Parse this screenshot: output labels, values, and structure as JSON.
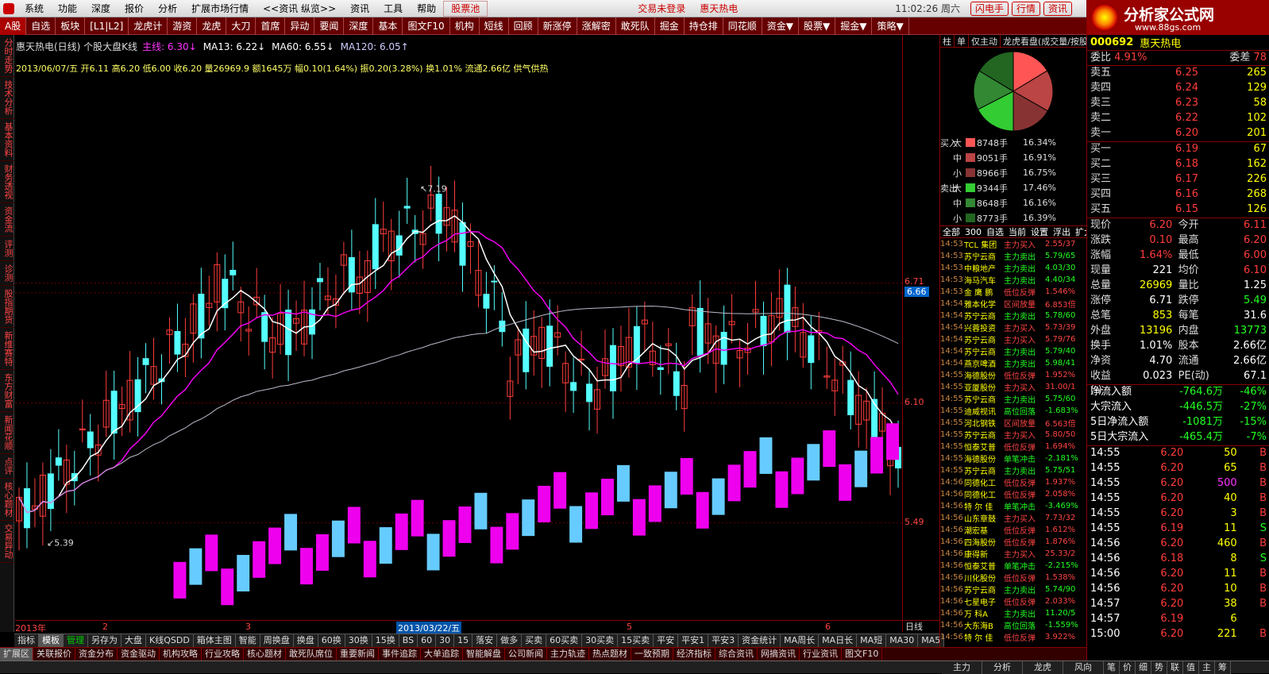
{
  "menubar": {
    "items": [
      "系统",
      "功能",
      "深度",
      "报价",
      "分析",
      "扩展市场行情",
      "<<资讯 纵览>>",
      "资讯",
      "工具",
      "帮助",
      "股票池"
    ],
    "login": "交易未登录",
    "stock": "惠天热电",
    "time": "11:02:26 周六",
    "buttons": [
      "闪电手",
      "行情",
      "资讯"
    ]
  },
  "tabbar": {
    "items": [
      "A股",
      "自选",
      "板块",
      "[L1|L2]",
      "龙虎计",
      "游资",
      "龙虎",
      "大刀",
      "首席",
      "异动",
      "要闻",
      "深度",
      "基本",
      "图文F10",
      "机构",
      "短线",
      "回顾",
      "新涨停",
      "涨解密",
      "敢死队",
      "掘金",
      "持仓排",
      "同花顺",
      "资金▼",
      "股票▼",
      "掘金▼",
      "策略▼"
    ]
  },
  "leftnav": [
    "分时走势",
    "技术分析",
    "基本资料",
    "财务透视",
    "资金流",
    "评测",
    "诊测",
    "股指期货",
    "新维赛特",
    "东方财富",
    "新闻花顺",
    "点评",
    "核心题材",
    "交易异动"
  ],
  "logo": {
    "text": "分析家公式网",
    "url": "www.88gs.com"
  },
  "chart": {
    "title": "惠天热电(日线) 个股大盘K线",
    "main_label": "主线: 6.30↓",
    "ma13": "MA13: 6.22↓",
    "ma60": "MA60: 6.55↓",
    "ma120": "MA120: 6.05↑",
    "info": "2013/06/07/五 开6.11 高6.20 低6.00 收6.20 量26969.9 额1645万 幅0.10(1.64%) 振0.20(3.28%) 换1.01% 流通2.66亿 供气供热",
    "high_label": "7.19",
    "low_label": "5.39",
    "price_axis": [
      "6.71",
      "6.66",
      "6.10",
      "5.49"
    ],
    "price_vals": [
      6.71,
      6.66,
      6.1,
      5.49
    ],
    "current_price": "6.66",
    "date_axis": [
      "2013年",
      "2",
      "3",
      "2013/03/22/五",
      "5",
      "6"
    ],
    "period": "日线",
    "colors": {
      "up": "#ff3c3c",
      "down": "#5ff",
      "white": "#fff",
      "ma_mag": "#e0e",
      "ma_grey": "#bbc",
      "vol_up": "#e0e",
      "vol_down": "#6cf"
    }
  },
  "bottom1": [
    "指标",
    "模板",
    "管理",
    "另存为",
    "大盘",
    "K线QSDD",
    "箱体主图",
    "智能",
    "周换盘",
    "换盘",
    "60换",
    "30换",
    "15换",
    "BS",
    "60",
    "30",
    "15",
    "落安",
    "做多",
    "买卖",
    "60买卖",
    "30买卖",
    "15买卖",
    "平安",
    "平安1",
    "平安3",
    "资金统计",
    "MA周长",
    "MA日长",
    "MA短",
    "MA30",
    "MA5"
  ],
  "bottom2": [
    "扩展区",
    "关联报价",
    "资金分布",
    "资金驱动",
    "机构攻略",
    "行业攻略",
    "核心题材",
    "敢死队席位",
    "重要新闻",
    "事件追踪",
    "大单追踪",
    "智能解盘",
    "公司新闻",
    "主力轨迹",
    "热点题材",
    "一致预期",
    "经济指标",
    "综合资讯",
    "网摘资讯",
    "行业资讯",
    "图文F10"
  ],
  "status_tabs": [
    "主力",
    "分析",
    "龙虎",
    "风向",
    "笔",
    "价",
    "细",
    "势",
    "联",
    "值",
    "主",
    "筹"
  ],
  "mid": {
    "tabs": [
      "柱",
      "单",
      "仅主动",
      "龙虎看盘(成交量/按股)"
    ],
    "flow": [
      {
        "side": "买入",
        "size": "大",
        "vol": "8748手",
        "pct": "16.34%",
        "color": "#ff5555"
      },
      {
        "side": "",
        "size": "中",
        "vol": "9051手",
        "pct": "16.91%",
        "color": "#b44"
      },
      {
        "side": "",
        "size": "小",
        "vol": "8966手",
        "pct": "16.75%",
        "color": "#833"
      },
      {
        "side": "卖出",
        "size": "大",
        "vol": "9344手",
        "pct": "17.46%",
        "color": "#3c3"
      },
      {
        "side": "",
        "size": "中",
        "vol": "8648手",
        "pct": "16.16%",
        "color": "#383"
      },
      {
        "side": "",
        "size": "小",
        "vol": "8773手",
        "pct": "16.39%",
        "color": "#262"
      }
    ],
    "filters": [
      "全部",
      "300",
      "自选",
      "当前",
      "设置",
      "浮出",
      "扩大"
    ],
    "list": [
      [
        "14:53",
        "TCL 集团",
        "主力买入",
        "2.55/37"
      ],
      [
        "14:53",
        "苏宁云商",
        "主力卖出",
        "5.79/65"
      ],
      [
        "14:53",
        "中粮地产",
        "主力卖出",
        "4.03/30"
      ],
      [
        "14:53",
        "海马汽车",
        "主力卖出",
        "4.40/34"
      ],
      [
        "14:53",
        "金 鹰 鹏",
        "低位反弹",
        "1.546%"
      ],
      [
        "14:54",
        "雅本化学",
        "区间放量",
        "6.853倍"
      ],
      [
        "14:54",
        "苏宁云商",
        "主力卖出",
        "5.78/60"
      ],
      [
        "14:54",
        "兴蓉投资",
        "主力买入",
        "5.73/39"
      ],
      [
        "14:54",
        "苏宁云商",
        "主力买入",
        "5.79/76"
      ],
      [
        "14:54",
        "苏宁云商",
        "主力卖出",
        "5.79/40"
      ],
      [
        "14:54",
        "燕京啤酒",
        "主力卖出",
        "5.98/41"
      ],
      [
        "14:55",
        "海德股份",
        "低位反弹",
        "1.952%"
      ],
      [
        "14:55",
        "亚厦股份",
        "主力买入",
        "31.00/1"
      ],
      [
        "14:55",
        "苏宁云商",
        "主力卖出",
        "5.75/60"
      ],
      [
        "14:55",
        "迪威视讯",
        "高位回落",
        "-1.683%"
      ],
      [
        "14:55",
        "河北钢铁",
        "区间放量",
        "6.563倍"
      ],
      [
        "14:55",
        "苏宁云商",
        "主力买入",
        "5.80/50"
      ],
      [
        "14:55",
        "恒泰艾普",
        "低位反弹",
        "1.694%"
      ],
      [
        "14:55",
        "海德股份",
        "单笔冲击",
        "-2.181%"
      ],
      [
        "14:55",
        "苏宁云商",
        "主力卖出",
        "5.75/51"
      ],
      [
        "14:56",
        "同德化工",
        "低位反弹",
        "1.937%"
      ],
      [
        "14:56",
        "同德化工",
        "低位反弹",
        "2.058%"
      ],
      [
        "14:56",
        "特 尔 佳",
        "单笔冲击",
        "-3.469%"
      ],
      [
        "14:56",
        "山东章鼓",
        "主力买入",
        "7.73/32"
      ],
      [
        "14:56",
        "潮宏基",
        "低位反弹",
        "1.612%"
      ],
      [
        "14:56",
        "四海股份",
        "低位反弹",
        "1.876%"
      ],
      [
        "14:56",
        "康得新",
        "主力买入",
        "25.33/2"
      ],
      [
        "14:56",
        "恒泰艾普",
        "单笔冲击",
        "-2.215%"
      ],
      [
        "14:56",
        "川化股份",
        "低位反弹",
        "1.538%"
      ],
      [
        "14:56",
        "苏宁云商",
        "主力卖出",
        "5.74/90"
      ],
      [
        "14:56",
        "七星电子",
        "低位反弹",
        "2.033%"
      ],
      [
        "14:56",
        "万 科A",
        "主力卖出",
        "11.20/5"
      ],
      [
        "14:56",
        "大东海B",
        "高位回落",
        "-1.559%"
      ],
      [
        "14:56",
        "特 尔 佳",
        "低位反弹",
        "3.922%"
      ]
    ]
  },
  "quote": {
    "code": "000692",
    "name": "惠天热电",
    "weibi": "4.91%",
    "weicha": "78",
    "asks": [
      [
        "卖五",
        "6.25",
        "265"
      ],
      [
        "卖四",
        "6.24",
        "129"
      ],
      [
        "卖三",
        "6.23",
        "58"
      ],
      [
        "卖二",
        "6.22",
        "102"
      ],
      [
        "卖一",
        "6.20",
        "201"
      ]
    ],
    "bids": [
      [
        "买一",
        "6.19",
        "67"
      ],
      [
        "买二",
        "6.18",
        "162"
      ],
      [
        "买三",
        "6.17",
        "226"
      ],
      [
        "买四",
        "6.16",
        "268"
      ],
      [
        "买五",
        "6.15",
        "126"
      ]
    ],
    "stats": [
      [
        "现价",
        "6.20",
        "今开",
        "6.11"
      ],
      [
        "涨跌",
        "0.10",
        "最高",
        "6.20"
      ],
      [
        "涨幅",
        "1.64%",
        "最低",
        "6.00"
      ],
      [
        "现量",
        "221",
        "均价",
        "6.10"
      ],
      [
        "总量",
        "26969",
        "量比",
        "1.25"
      ],
      [
        "涨停",
        "6.71",
        "跌停",
        "5.49"
      ],
      [
        "总笔",
        "853",
        "每笔",
        "31.6"
      ],
      [
        "外盘",
        "13196",
        "内盘",
        "13773"
      ],
      [
        "换手",
        "1.01%",
        "股本",
        "2.66亿"
      ],
      [
        "净资",
        "4.70",
        "流通",
        "2.66亿"
      ],
      [
        "收益(-)",
        "0.023",
        "PE(动)",
        "67.1"
      ]
    ],
    "flows": [
      [
        "净流入额",
        "-764.6万",
        "-46%"
      ],
      [
        "大宗流入",
        "-446.5万",
        "-27%"
      ],
      [
        "5日净流入额",
        "-1081万",
        "-15%"
      ],
      [
        "5日大宗流入",
        "-465.4万",
        "-7%"
      ]
    ],
    "ticks": [
      [
        "14:55",
        "6.20",
        "50",
        "B"
      ],
      [
        "14:55",
        "6.20",
        "65",
        "B"
      ],
      [
        "14:55",
        "6.20",
        "500",
        "B"
      ],
      [
        "14:55",
        "6.20",
        "40",
        "B"
      ],
      [
        "14:55",
        "6.20",
        "3",
        "B"
      ],
      [
        "14:55",
        "6.19",
        "11",
        "S"
      ],
      [
        "14:56",
        "6.20",
        "460",
        "B"
      ],
      [
        "14:56",
        "6.18",
        "8",
        "S"
      ],
      [
        "14:56",
        "6.20",
        "11",
        "B"
      ],
      [
        "14:56",
        "6.20",
        "10",
        "B"
      ],
      [
        "14:57",
        "6.20",
        "38",
        "B"
      ],
      [
        "14:57",
        "6.19",
        "6",
        ""
      ],
      [
        "15:00",
        "6.20",
        "221",
        "B"
      ]
    ]
  }
}
